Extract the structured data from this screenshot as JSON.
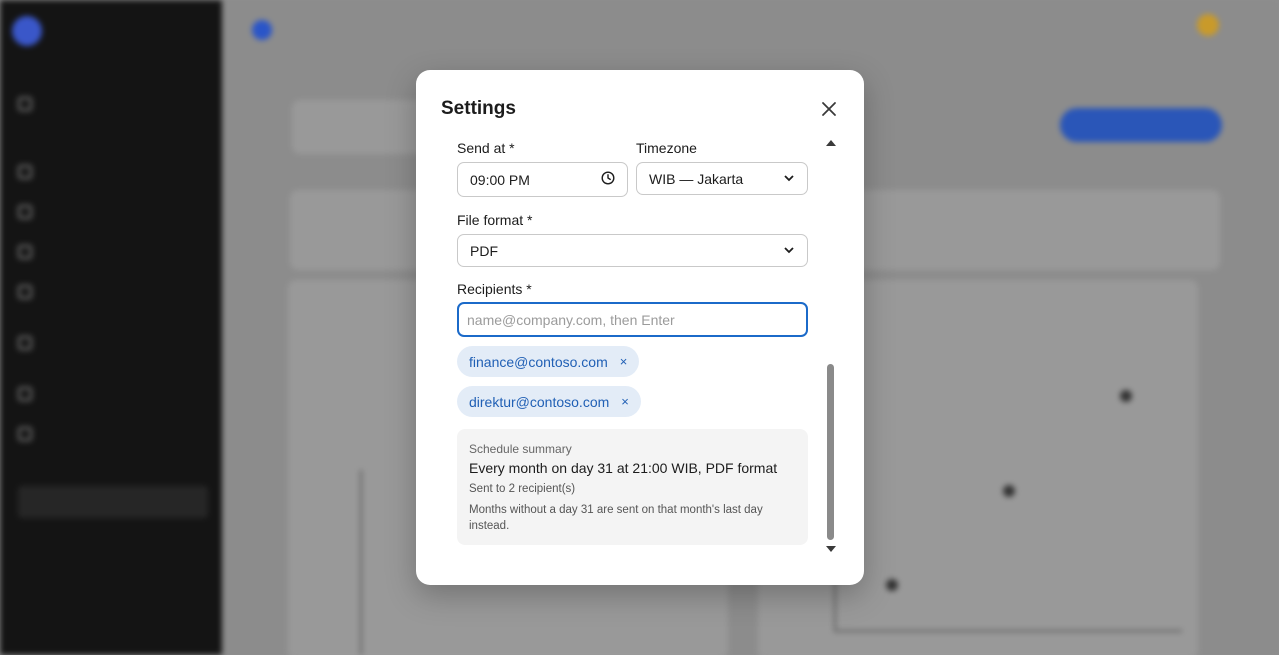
{
  "modal": {
    "title": "Settings",
    "close_icon": "close-icon",
    "send_at": {
      "label": "Send at *",
      "value": "09:00 PM",
      "icon": "clock-icon"
    },
    "timezone": {
      "label": "Timezone",
      "value": "WIB — Jakarta"
    },
    "file_format": {
      "label": "File format *",
      "value": "PDF"
    },
    "recipients": {
      "label": "Recipients *",
      "placeholder": "name@company.com, then Enter",
      "chips": [
        {
          "email": "finance@contoso.com",
          "remove": "×"
        },
        {
          "email": "direktur@contoso.com",
          "remove": "×"
        }
      ]
    },
    "summary": {
      "label": "Schedule summary",
      "main": "Every month on day 31 at 21:00 WIB, PDF format",
      "sent": "Sent to 2 recipient(s)",
      "note": "Months without a day 31 are sent on that month's last day instead."
    }
  }
}
